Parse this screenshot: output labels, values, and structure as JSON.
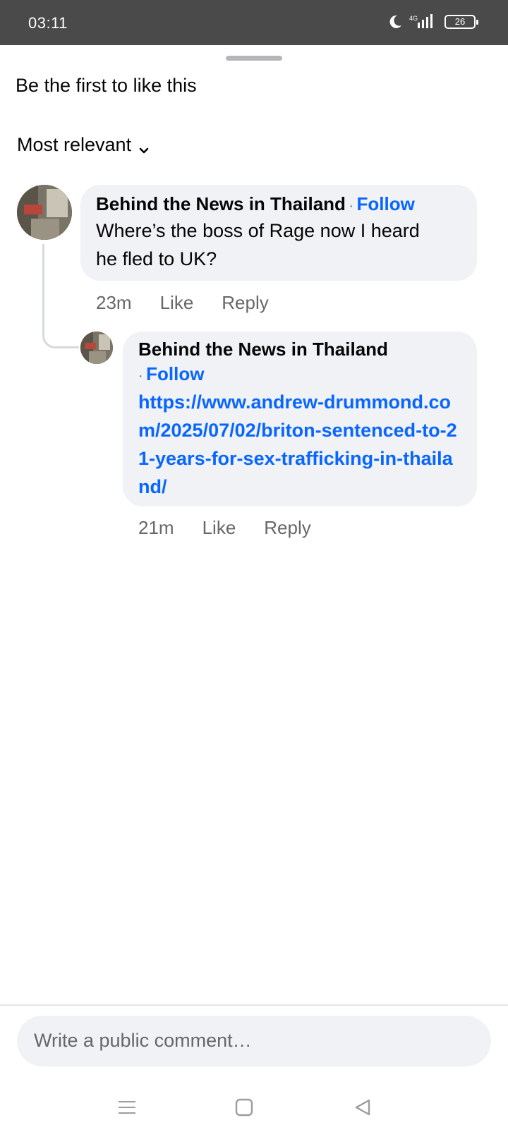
{
  "status_bar": {
    "time": "03:11",
    "network": "4G",
    "battery": "26",
    "icons": [
      "moon-icon",
      "signal-icon",
      "battery-icon"
    ]
  },
  "sheet": {
    "reactions_summary": "Be the first to like this",
    "sort_label": "Most relevant"
  },
  "comments": [
    {
      "author": "Behind the News in Thailand",
      "separator": "·",
      "follow_label": "Follow",
      "text": "Where’s the boss of Rage now I heard he fled to UK?",
      "time": "23m",
      "like_label": "Like",
      "reply_label": "Reply"
    },
    {
      "author": "Behind the News in Thailand",
      "separator": "·",
      "follow_label": "Follow",
      "link": "https://www.andrew-drummond.com/2025/07/02/briton-sentenced-to-21-years-for-sex-trafficking-in-thailand/",
      "time": "21m",
      "like_label": "Like",
      "reply_label": "Reply"
    }
  ],
  "composer": {
    "placeholder": "Write a public comment…"
  },
  "nav_bar": {
    "icons": [
      "menu-icon",
      "home-square-icon",
      "back-triangle-icon"
    ]
  },
  "colors": {
    "status_bar": "#4a4a4a",
    "bubble": "#f0f2f5",
    "link": "#0866ff",
    "secondary_text": "#65676b"
  }
}
